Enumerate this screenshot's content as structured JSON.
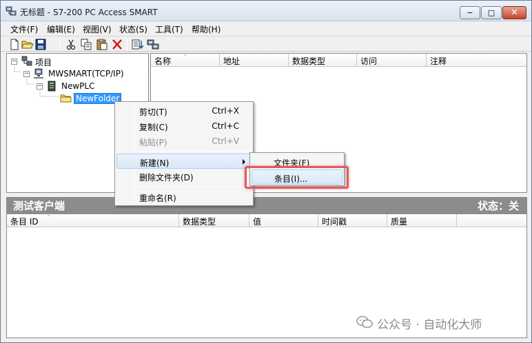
{
  "window": {
    "title": "无标题 - S7-200 PC Access SMART",
    "controls": {
      "minimize": "−",
      "maximize": "□",
      "close": "✕"
    }
  },
  "menu": [
    {
      "label": "文件(F)"
    },
    {
      "label": "编辑(E)"
    },
    {
      "label": "视图(V)"
    },
    {
      "label": "状态(S)"
    },
    {
      "label": "工具(T)"
    },
    {
      "label": "帮助(H)"
    }
  ],
  "toolbar": {
    "icons": [
      "new-file-icon",
      "open-folder-icon",
      "save-icon",
      "cut-icon",
      "copy-icon",
      "paste-icon",
      "delete-icon",
      "add-item-icon",
      "monitor-icon"
    ]
  },
  "tree": {
    "root": "项目",
    "connection": "MWSMART(TCP/IP)",
    "plc": "NewPLC",
    "folder": "NewFolder",
    "expander_open": "−"
  },
  "item_list": {
    "columns": [
      "名称",
      "地址",
      "数据类型",
      "访问",
      "注释"
    ],
    "sort_indicator": "ˊ"
  },
  "test_client": {
    "title": "测试客户端",
    "status": "状态：关",
    "columns": [
      "条目 ID",
      "数据类型",
      "值",
      "时间戳",
      "质量"
    ],
    "sort_indicator": "ˊ"
  },
  "context_menu": {
    "items": [
      {
        "label": "剪切(T)",
        "shortcut": "Ctrl+X",
        "disabled": false
      },
      {
        "label": "复制(C)",
        "shortcut": "Ctrl+C",
        "disabled": false
      },
      {
        "label": "粘贴(P)",
        "shortcut": "Ctrl+V",
        "disabled": true
      },
      {
        "label": "新建(N)",
        "shortcut": "",
        "disabled": false
      },
      {
        "label": "删除文件夹(D)",
        "shortcut": "",
        "disabled": false
      },
      {
        "label": "重命名(R)",
        "shortcut": "",
        "disabled": false
      }
    ]
  },
  "submenu": {
    "items": [
      {
        "label": "文件夹(F)"
      },
      {
        "label": "条目(I)..."
      }
    ]
  },
  "watermark": {
    "text": "公众号 · 自动化大师"
  },
  "colors": {
    "selection": "#3399ff",
    "band": "#8c8c8c",
    "highlight": "#e25a5a"
  }
}
